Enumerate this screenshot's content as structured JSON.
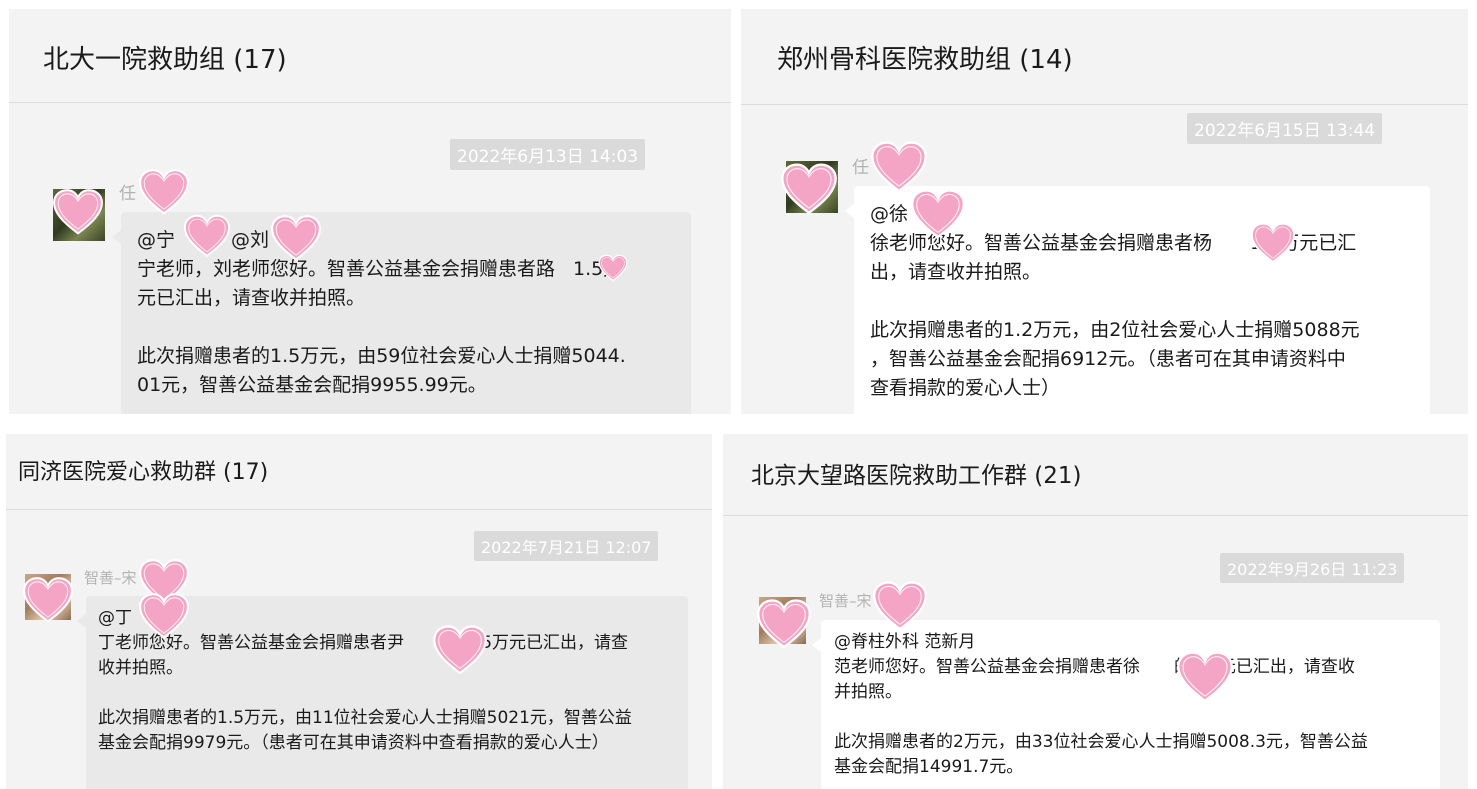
{
  "colors": {
    "panel_bg": "#f3f3f3",
    "bubble_grey": "#e9e9e9",
    "bubble_white": "#ffffff",
    "timestamp_bg": "#dadada",
    "heart_fill": "#f4a4c4",
    "heart_stroke": "#ffffff"
  },
  "panels": [
    {
      "title": "北大一院救助组 (17)",
      "timestamp": "2022年6月13日 14:03",
      "sender": "任",
      "mention": "@宁",
      "mention2": "@刘",
      "lines": [
        "宁老师，刘老师您好。智善公益基金会捐赠患者路",
        "1.5万",
        "元已汇出，请查收并拍照。",
        "此次捐赠患者的1.5万元，由59位社会爱心人士捐赠5044.",
        "01元，智善公益基金会配捐9955.99元。"
      ]
    },
    {
      "title": "郑州骨科医院救助组 (14)",
      "timestamp": "2022年6月15日 13:44",
      "sender": "任",
      "mention": "@徐",
      "lines": [
        "徐老师您好。智善公益基金会捐赠患者杨",
        "1.2万元已汇",
        "出，请查收并拍照。",
        "此次捐赠患者的1.2万元，由2位社会爱心人士捐赠5088元",
        "，智善公益基金会配捐6912元。（患者可在其申请资料中",
        "查看捐款的爱心人士）"
      ]
    },
    {
      "title": "同济医院爱心救助群 (17)",
      "timestamp": "2022年7月21日 12:07",
      "sender": "智善–宋",
      "mention": "@丁",
      "lines": [
        "丁老师您好。智善公益基金会捐赠患者尹",
        "的1.5万元已汇出，请查",
        "收并拍照。",
        "此次捐赠患者的1.5万元，由11位社会爱心人士捐赠5021元，智善公益",
        "基金会配捐9979元。（患者可在其申请资料中查看捐款的爱心人士）"
      ]
    },
    {
      "title": "北京大望路医院救助工作群 (21)",
      "timestamp": "2022年9月26日 11:23",
      "sender": "智善–宋",
      "mention": "@脊柱外科 范新月",
      "lines": [
        "范老师您好。智善公益基金会捐赠患者徐",
        "的2万元已汇出，请查收",
        "并拍照。",
        "此次捐赠患者的2万元，由33位社会爱心人士捐赠5008.3元，智善公益",
        "基金会配捐14991.7元。"
      ]
    }
  ]
}
